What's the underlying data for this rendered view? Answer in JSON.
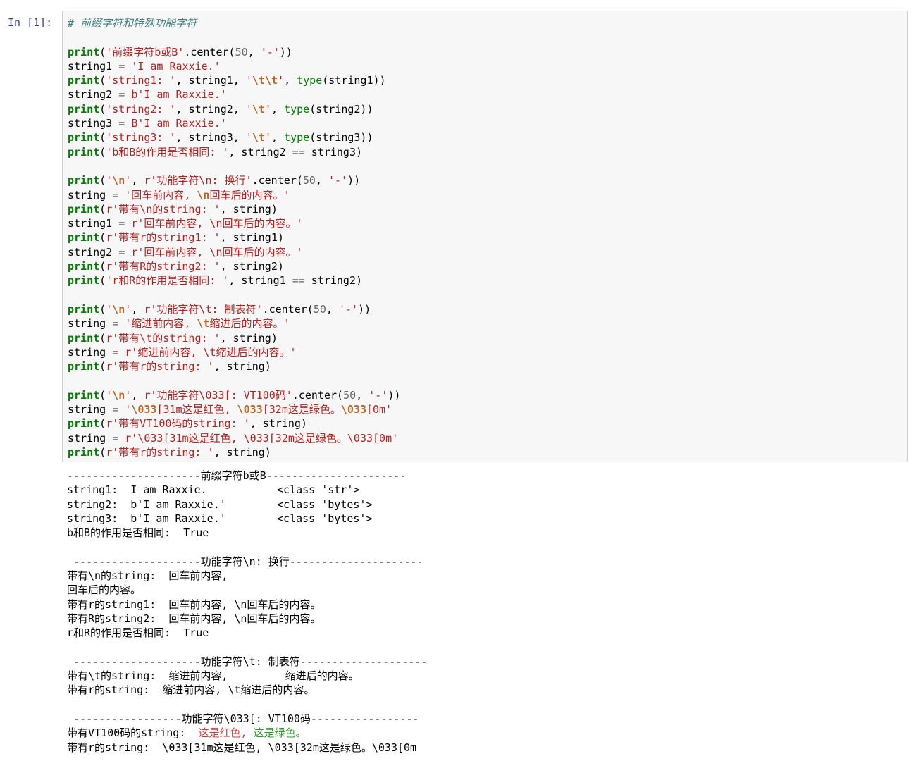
{
  "cell": {
    "prompt": "In [1]:",
    "code": [
      {
        "id": "l1",
        "tokens": [
          {
            "t": "# 前缀字符和特殊功能字符",
            "c": "com"
          }
        ]
      },
      {
        "id": "l2",
        "tokens": []
      },
      {
        "id": "l3",
        "tokens": [
          {
            "t": "print",
            "c": "kw"
          },
          {
            "t": "("
          },
          {
            "t": "'前缀字符b或B'",
            "c": "str"
          },
          {
            "t": ".center("
          },
          {
            "t": "50",
            "c": "num"
          },
          {
            "t": ", "
          },
          {
            "t": "'-'",
            "c": "str"
          },
          {
            "t": "))"
          }
        ]
      },
      {
        "id": "l4",
        "tokens": [
          {
            "t": "string1 "
          },
          {
            "t": "=",
            "c": "op"
          },
          {
            "t": " "
          },
          {
            "t": "'I am Raxxie.'",
            "c": "str"
          }
        ]
      },
      {
        "id": "l5",
        "tokens": [
          {
            "t": "print",
            "c": "kw"
          },
          {
            "t": "("
          },
          {
            "t": "'string1: '",
            "c": "str"
          },
          {
            "t": ", string1, "
          },
          {
            "t": "'",
            "c": "str"
          },
          {
            "t": "\\t\\t",
            "c": "esc"
          },
          {
            "t": "'",
            "c": "str"
          },
          {
            "t": ", "
          },
          {
            "t": "type",
            "c": "bi"
          },
          {
            "t": "(string1))"
          }
        ]
      },
      {
        "id": "l6",
        "tokens": [
          {
            "t": "string2 "
          },
          {
            "t": "=",
            "c": "op"
          },
          {
            "t": " "
          },
          {
            "t": "b'I am Raxxie.'",
            "c": "str"
          }
        ]
      },
      {
        "id": "l7",
        "tokens": [
          {
            "t": "print",
            "c": "kw"
          },
          {
            "t": "("
          },
          {
            "t": "'string2: '",
            "c": "str"
          },
          {
            "t": ", string2, "
          },
          {
            "t": "'",
            "c": "str"
          },
          {
            "t": "\\t",
            "c": "esc"
          },
          {
            "t": "'",
            "c": "str"
          },
          {
            "t": ", "
          },
          {
            "t": "type",
            "c": "bi"
          },
          {
            "t": "(string2))"
          }
        ]
      },
      {
        "id": "l8",
        "tokens": [
          {
            "t": "string3 "
          },
          {
            "t": "=",
            "c": "op"
          },
          {
            "t": " "
          },
          {
            "t": "B'I am Raxxie.'",
            "c": "str"
          }
        ]
      },
      {
        "id": "l9",
        "tokens": [
          {
            "t": "print",
            "c": "kw"
          },
          {
            "t": "("
          },
          {
            "t": "'string3: '",
            "c": "str"
          },
          {
            "t": ", string3, "
          },
          {
            "t": "'",
            "c": "str"
          },
          {
            "t": "\\t",
            "c": "esc"
          },
          {
            "t": "'",
            "c": "str"
          },
          {
            "t": ", "
          },
          {
            "t": "type",
            "c": "bi"
          },
          {
            "t": "(string3))"
          }
        ]
      },
      {
        "id": "l10",
        "tokens": [
          {
            "t": "print",
            "c": "kw"
          },
          {
            "t": "("
          },
          {
            "t": "'b和B的作用是否相同: '",
            "c": "str"
          },
          {
            "t": ", string2 "
          },
          {
            "t": "==",
            "c": "op"
          },
          {
            "t": " string3)"
          }
        ]
      },
      {
        "id": "l11",
        "tokens": []
      },
      {
        "id": "l12",
        "tokens": [
          {
            "t": "print",
            "c": "kw"
          },
          {
            "t": "("
          },
          {
            "t": "'",
            "c": "str"
          },
          {
            "t": "\\n",
            "c": "esc"
          },
          {
            "t": "'",
            "c": "str"
          },
          {
            "t": ", "
          },
          {
            "t": "r'功能字符\\n: 换行'",
            "c": "str"
          },
          {
            "t": ".center("
          },
          {
            "t": "50",
            "c": "num"
          },
          {
            "t": ", "
          },
          {
            "t": "'-'",
            "c": "str"
          },
          {
            "t": "))"
          }
        ]
      },
      {
        "id": "l13",
        "tokens": [
          {
            "t": "string "
          },
          {
            "t": "=",
            "c": "op"
          },
          {
            "t": " "
          },
          {
            "t": "'回车前内容, ",
            "c": "str"
          },
          {
            "t": "\\n",
            "c": "esc"
          },
          {
            "t": "回车后的内容。'",
            "c": "str"
          }
        ]
      },
      {
        "id": "l14",
        "tokens": [
          {
            "t": "print",
            "c": "kw"
          },
          {
            "t": "("
          },
          {
            "t": "r'带有\\n的string: '",
            "c": "str"
          },
          {
            "t": ", string)"
          }
        ]
      },
      {
        "id": "l15",
        "tokens": [
          {
            "t": "string1 "
          },
          {
            "t": "=",
            "c": "op"
          },
          {
            "t": " "
          },
          {
            "t": "r'回车前内容, \\n回车后的内容。'",
            "c": "str"
          }
        ]
      },
      {
        "id": "l16",
        "tokens": [
          {
            "t": "print",
            "c": "kw"
          },
          {
            "t": "("
          },
          {
            "t": "r'带有r的string1: '",
            "c": "str"
          },
          {
            "t": ", string1)"
          }
        ]
      },
      {
        "id": "l17",
        "tokens": [
          {
            "t": "string2 "
          },
          {
            "t": "=",
            "c": "op"
          },
          {
            "t": " "
          },
          {
            "t": "r'回车前内容, \\n回车后的内容。'",
            "c": "str"
          }
        ]
      },
      {
        "id": "l18",
        "tokens": [
          {
            "t": "print",
            "c": "kw"
          },
          {
            "t": "("
          },
          {
            "t": "r'带有R的string2: '",
            "c": "str"
          },
          {
            "t": ", string2)"
          }
        ]
      },
      {
        "id": "l19",
        "tokens": [
          {
            "t": "print",
            "c": "kw"
          },
          {
            "t": "("
          },
          {
            "t": "'r和R的作用是否相同: '",
            "c": "str"
          },
          {
            "t": ", string1 "
          },
          {
            "t": "==",
            "c": "op"
          },
          {
            "t": " string2)"
          }
        ]
      },
      {
        "id": "l20",
        "tokens": []
      },
      {
        "id": "l21",
        "tokens": [
          {
            "t": "print",
            "c": "kw"
          },
          {
            "t": "("
          },
          {
            "t": "'",
            "c": "str"
          },
          {
            "t": "\\n",
            "c": "esc"
          },
          {
            "t": "'",
            "c": "str"
          },
          {
            "t": ", "
          },
          {
            "t": "r'功能字符\\t: 制表符'",
            "c": "str"
          },
          {
            "t": ".center("
          },
          {
            "t": "50",
            "c": "num"
          },
          {
            "t": ", "
          },
          {
            "t": "'-'",
            "c": "str"
          },
          {
            "t": "))"
          }
        ]
      },
      {
        "id": "l22",
        "tokens": [
          {
            "t": "string "
          },
          {
            "t": "=",
            "c": "op"
          },
          {
            "t": " "
          },
          {
            "t": "'缩进前内容, ",
            "c": "str"
          },
          {
            "t": "\\t",
            "c": "esc"
          },
          {
            "t": "缩进后的内容。'",
            "c": "str"
          }
        ]
      },
      {
        "id": "l23",
        "tokens": [
          {
            "t": "print",
            "c": "kw"
          },
          {
            "t": "("
          },
          {
            "t": "r'带有\\t的string: '",
            "c": "str"
          },
          {
            "t": ", string)"
          }
        ]
      },
      {
        "id": "l24",
        "tokens": [
          {
            "t": "string "
          },
          {
            "t": "=",
            "c": "op"
          },
          {
            "t": " "
          },
          {
            "t": "r'缩进前内容, \\t缩进后的内容。'",
            "c": "str"
          }
        ]
      },
      {
        "id": "l25",
        "tokens": [
          {
            "t": "print",
            "c": "kw"
          },
          {
            "t": "("
          },
          {
            "t": "r'带有r的string: '",
            "c": "str"
          },
          {
            "t": ", string)"
          }
        ]
      },
      {
        "id": "l26",
        "tokens": []
      },
      {
        "id": "l27",
        "tokens": [
          {
            "t": "print",
            "c": "kw"
          },
          {
            "t": "("
          },
          {
            "t": "'",
            "c": "str"
          },
          {
            "t": "\\n",
            "c": "esc"
          },
          {
            "t": "'",
            "c": "str"
          },
          {
            "t": ", "
          },
          {
            "t": "r'功能字符\\033[: VT100码'",
            "c": "str"
          },
          {
            "t": ".center("
          },
          {
            "t": "50",
            "c": "num"
          },
          {
            "t": ", "
          },
          {
            "t": "'-'",
            "c": "str"
          },
          {
            "t": "))"
          }
        ]
      },
      {
        "id": "l28",
        "tokens": [
          {
            "t": "string "
          },
          {
            "t": "=",
            "c": "op"
          },
          {
            "t": " "
          },
          {
            "t": "'",
            "c": "str"
          },
          {
            "t": "\\033",
            "c": "esc"
          },
          {
            "t": "[31m这是红色, ",
            "c": "str"
          },
          {
            "t": "\\033",
            "c": "esc"
          },
          {
            "t": "[32m这是绿色。",
            "c": "str"
          },
          {
            "t": "\\033",
            "c": "esc"
          },
          {
            "t": "[0m'",
            "c": "str"
          }
        ]
      },
      {
        "id": "l29",
        "tokens": [
          {
            "t": "print",
            "c": "kw"
          },
          {
            "t": "("
          },
          {
            "t": "r'带有VT100码的string: '",
            "c": "str"
          },
          {
            "t": ", string)"
          }
        ]
      },
      {
        "id": "l30",
        "tokens": [
          {
            "t": "string "
          },
          {
            "t": "=",
            "c": "op"
          },
          {
            "t": " "
          },
          {
            "t": "r'\\033[31m这是红色, \\033[32m这是绿色。\\033[0m'",
            "c": "str"
          }
        ]
      },
      {
        "id": "l31",
        "tokens": [
          {
            "t": "print",
            "c": "kw"
          },
          {
            "t": "("
          },
          {
            "t": "r'带有r的string: '",
            "c": "str"
          },
          {
            "t": ", string)"
          }
        ]
      }
    ]
  },
  "output": [
    {
      "id": "o1",
      "tokens": [
        {
          "t": "---------------------前缀字符b或B----------------------"
        }
      ]
    },
    {
      "id": "o2",
      "tokens": [
        {
          "t": "string1:  I am Raxxie.           <class 'str'>"
        }
      ]
    },
    {
      "id": "o3",
      "tokens": [
        {
          "t": "string2:  b'I am Raxxie.'        <class 'bytes'>"
        }
      ]
    },
    {
      "id": "o4",
      "tokens": [
        {
          "t": "string3:  b'I am Raxxie.'        <class 'bytes'>"
        }
      ]
    },
    {
      "id": "o5",
      "tokens": [
        {
          "t": "b和B的作用是否相同:  True"
        }
      ]
    },
    {
      "id": "o6",
      "tokens": []
    },
    {
      "id": "o7",
      "tokens": [
        {
          "t": " --------------------功能字符\\n: 换行---------------------"
        }
      ]
    },
    {
      "id": "o8",
      "tokens": [
        {
          "t": "带有\\n的string:  回车前内容,"
        }
      ]
    },
    {
      "id": "o9",
      "tokens": [
        {
          "t": "回车后的内容。"
        }
      ]
    },
    {
      "id": "o10",
      "tokens": [
        {
          "t": "带有r的string1:  回车前内容, \\n回车后的内容。"
        }
      ]
    },
    {
      "id": "o11",
      "tokens": [
        {
          "t": "带有R的string2:  回车前内容, \\n回车后的内容。"
        }
      ]
    },
    {
      "id": "o12",
      "tokens": [
        {
          "t": "r和R的作用是否相同:  True"
        }
      ]
    },
    {
      "id": "o13",
      "tokens": []
    },
    {
      "id": "o14",
      "tokens": [
        {
          "t": " --------------------功能字符\\t: 制表符--------------------"
        }
      ]
    },
    {
      "id": "o15",
      "tokens": [
        {
          "t": "带有\\t的string:  缩进前内容,         缩进后的内容。"
        }
      ]
    },
    {
      "id": "o16",
      "tokens": [
        {
          "t": "带有r的string:  缩进前内容, \\t缩进后的内容。"
        }
      ]
    },
    {
      "id": "o17",
      "tokens": []
    },
    {
      "id": "o18",
      "tokens": [
        {
          "t": " -----------------功能字符\\033[: VT100码-----------------"
        }
      ]
    },
    {
      "id": "o19",
      "tokens": [
        {
          "t": "带有VT100码的string:  "
        },
        {
          "t": "这是红色, ",
          "c": "red"
        },
        {
          "t": "这是绿色。",
          "c": "grn"
        }
      ]
    },
    {
      "id": "o20",
      "tokens": [
        {
          "t": "带有r的string:  \\033[31m这是红色, \\033[32m这是绿色。\\033[0m"
        }
      ]
    }
  ],
  "colors": {
    "prompt": "#303f9f",
    "cell_bg": "#f7f7f7",
    "cell_border": "#cfcfcf",
    "keyword": "#008000",
    "string": "#ba2121",
    "escape": "#bb6622",
    "comment": "#408080",
    "ansi_red": "#d04040",
    "ansi_green": "#2e9a2e"
  }
}
